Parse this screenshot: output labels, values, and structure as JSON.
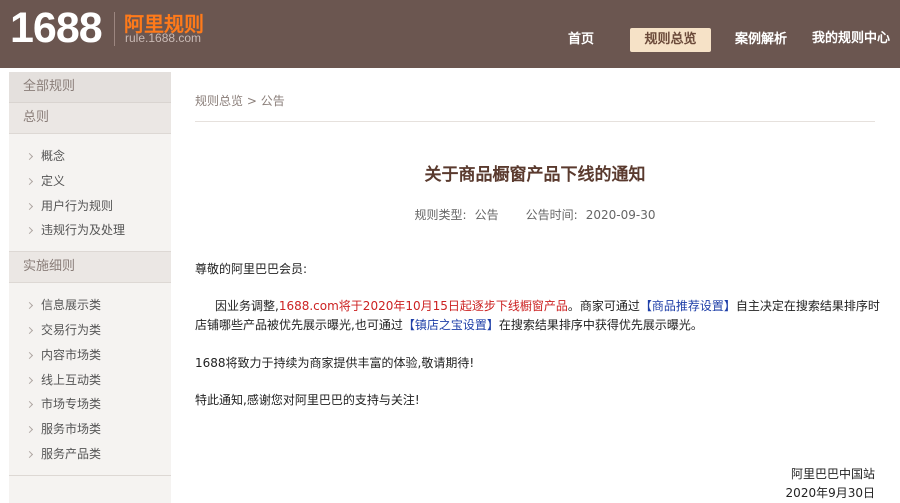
{
  "header": {
    "logo_number": "1688",
    "logo_title": "阿里规则",
    "logo_url": "rule.1688.com",
    "nav": [
      {
        "label": "首页",
        "active": false
      },
      {
        "label": "规则总览",
        "active": true
      },
      {
        "label": "案例解析",
        "active": false
      },
      {
        "label": "我的规则中心",
        "active": false
      }
    ]
  },
  "sidebar": {
    "all_rules": "全部规则",
    "section1": "总则",
    "section1_items": [
      "概念",
      "定义",
      "用户行为规则",
      "违规行为及处理"
    ],
    "section2": "实施细则",
    "section2_items": [
      "信息展示类",
      "交易行为类",
      "内容市场类",
      "线上互动类",
      "市场专场类",
      "服务市场类",
      "服务产品类"
    ]
  },
  "breadcrumb": {
    "root": "规则总览",
    "sep": ">",
    "current": "公告"
  },
  "notice": {
    "title": "关于商品橱窗产品下线的通知",
    "type_label": "规则类型:",
    "type_value": "公告",
    "time_label": "公告时间:",
    "time_value": "2020-09-30",
    "greeting": "尊敬的阿里巴巴会员:",
    "p1_lead": "因业务调整,",
    "p1_red": "1688.com将于2020年10月15日起逐步下线橱窗产品",
    "p1_mid1": "。商家可通过",
    "p1_link1": "【商品推荐设置】",
    "p1_mid2": "自主决定在搜索结果排序时店铺哪些产品被优先展示曝光,也可通过",
    "p1_link2": "【镇店之宝设置】",
    "p1_tail": "在搜索结果排序中获得优先展示曝光。",
    "p2": "1688将致力于持续为商家提供丰富的体验,敬请期待!",
    "p3": "特此通知,感谢您对阿里巴巴的支持与关注!",
    "sign_org": "阿里巴巴中国站",
    "sign_date": "2020年9月30日"
  }
}
